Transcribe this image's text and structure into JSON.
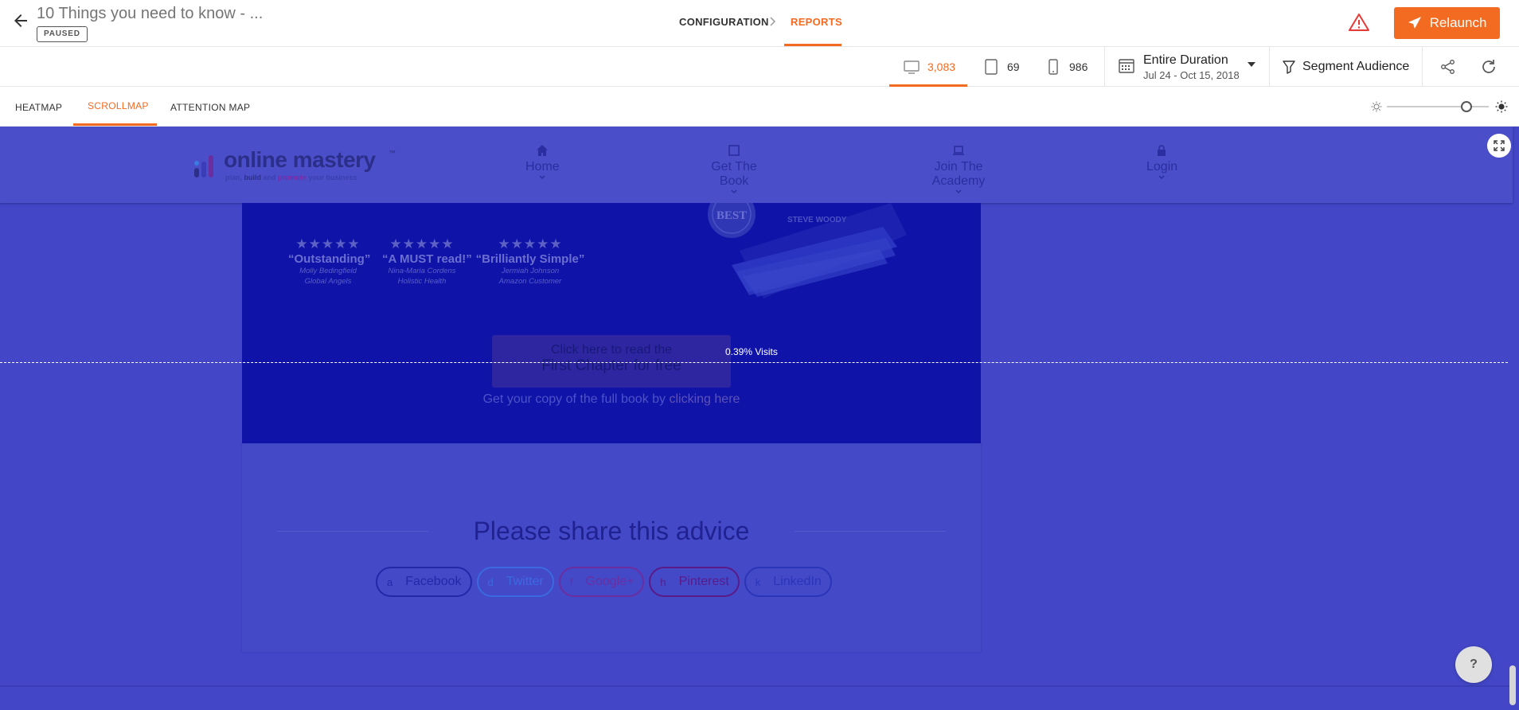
{
  "header": {
    "title": "10 Things you need to know - ...",
    "status": "PAUSED",
    "breadcrumb": [
      "CONFIGURATION",
      "REPORTS"
    ],
    "relaunch_label": "Relaunch"
  },
  "stats": {
    "desktop": "3,083",
    "tablet": "69",
    "mobile": "986",
    "date_label": "Entire Duration",
    "date_range": "Jul 24 - Oct 15, 2018",
    "segment_label": "Segment Audience"
  },
  "modes": {
    "tabs": [
      "HEATMAP",
      "SCROLLMAP",
      "ATTENTION MAP"
    ],
    "active": "SCROLLMAP",
    "brightness_level": 0.78
  },
  "site": {
    "logo_name": "online mastery",
    "logo_tm": "™",
    "logo_tag_1": "plan, ",
    "logo_tag_2": "build ",
    "logo_tag_3": "and ",
    "logo_tag_4": "promote ",
    "logo_tag_5": "your business",
    "nav": [
      "Home",
      "Get The Book",
      "Join The Academy",
      "Login"
    ],
    "reviews": [
      {
        "quote": "“Outstanding”",
        "name": "Molly Bedingfield",
        "org": "Global Angels"
      },
      {
        "quote": "“A MUST read!”",
        "name": "Nina-Maria Cordens",
        "org": "Holistic Health"
      },
      {
        "quote": "“Brilliantly Simple”",
        "name": "Jermiah Johnson",
        "org": "Amazon Customer"
      }
    ],
    "stars": "★★★★★",
    "book_badge": "BEST",
    "book_author": "STEVE WOODY",
    "cta_line1": "Click here to read the",
    "cta_line2": "First Chapter for free",
    "copy_text": "Get your copy of the full book by ",
    "copy_link": "clicking here",
    "share_title": "Please share this advice",
    "share_buttons": [
      {
        "icon": "a",
        "label": "Facebook"
      },
      {
        "icon": "d",
        "label": "Twitter"
      },
      {
        "icon": "f",
        "label": "Google+"
      },
      {
        "icon": "h",
        "label": "Pinterest"
      },
      {
        "icon": "k",
        "label": "LinkedIn"
      }
    ]
  },
  "scrollmap": {
    "fold_label": "0.39% Visits"
  },
  "help_label": "?",
  "colors": {
    "accent": "#f26b21",
    "overlay": "#4347c7",
    "hero": "#0f13a8"
  }
}
